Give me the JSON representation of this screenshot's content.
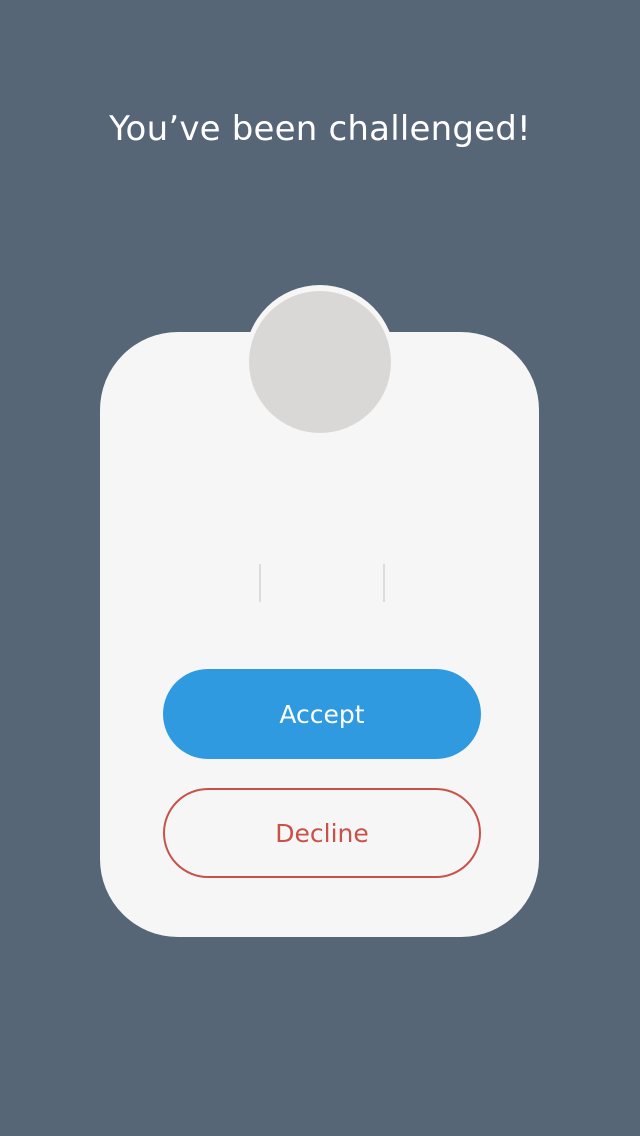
{
  "challenge": {
    "title": "You’ve been challenged!"
  },
  "actions": {
    "accept_label": "Accept",
    "decline_label": "Decline"
  },
  "colors": {
    "background": "#566677",
    "title_text": "#ffffff",
    "card": "#f6f6f6",
    "avatar": "#d9d8d7",
    "divider": "#dcdcdc",
    "accept": "#2f9ae0",
    "accept_text": "#ffffff",
    "decline": "#c8524a"
  }
}
